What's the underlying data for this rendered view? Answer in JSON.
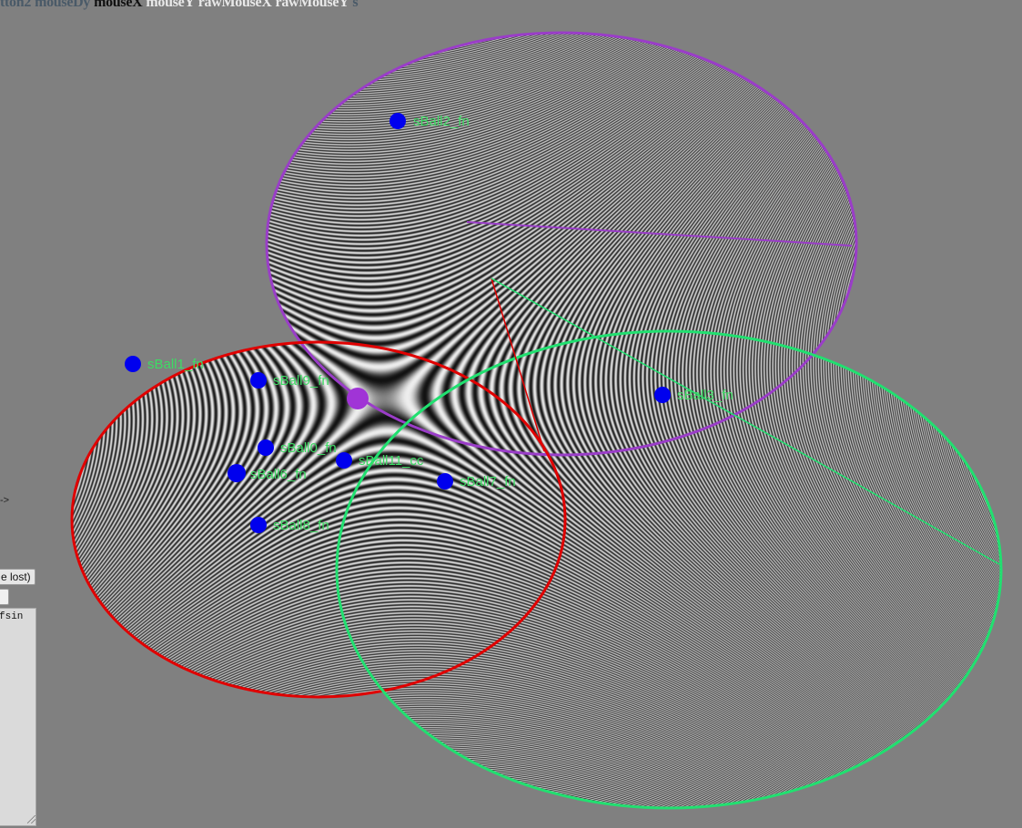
{
  "topbar": {
    "vars": [
      {
        "text": "tton2",
        "color": "#4a5a68"
      },
      {
        "text": "mouseDy",
        "color": "#4a5a68"
      },
      {
        "text": "mouseX",
        "color": "#111111"
      },
      {
        "text": "mouseY",
        "color": "#e8e8e8"
      },
      {
        "text": "rawMouseX",
        "color": "#e8e8e8"
      },
      {
        "text": "rawMouseY",
        "color": "#e8e8e8"
      },
      {
        "text": "s",
        "color": "#4a5a68"
      }
    ]
  },
  "leftpanel": {
    "arrow_text": "->",
    "button_label": "e lost)",
    "code_text": "fsin"
  },
  "balls": [
    {
      "label": "sBall2_fn"
    },
    {
      "label": "sBall1_fn"
    },
    {
      "label": "sBall9_fn"
    },
    {
      "label": "sBall3_fn"
    },
    {
      "label": "sBall0_fn"
    },
    {
      "label": "sBall11_cc"
    },
    {
      "label": "sBall6_fn"
    },
    {
      "label": "sBall7_fn"
    },
    {
      "label": "sBall8_fn"
    }
  ],
  "colors": {
    "background": "#808080",
    "ball_marker": "#0000ee",
    "ball_label": "#3ddc64",
    "purple_circle": "#9a3dc8",
    "red_circle": "#e00000",
    "green_circle": "#21e070",
    "purple_dot": "#a034d6"
  }
}
